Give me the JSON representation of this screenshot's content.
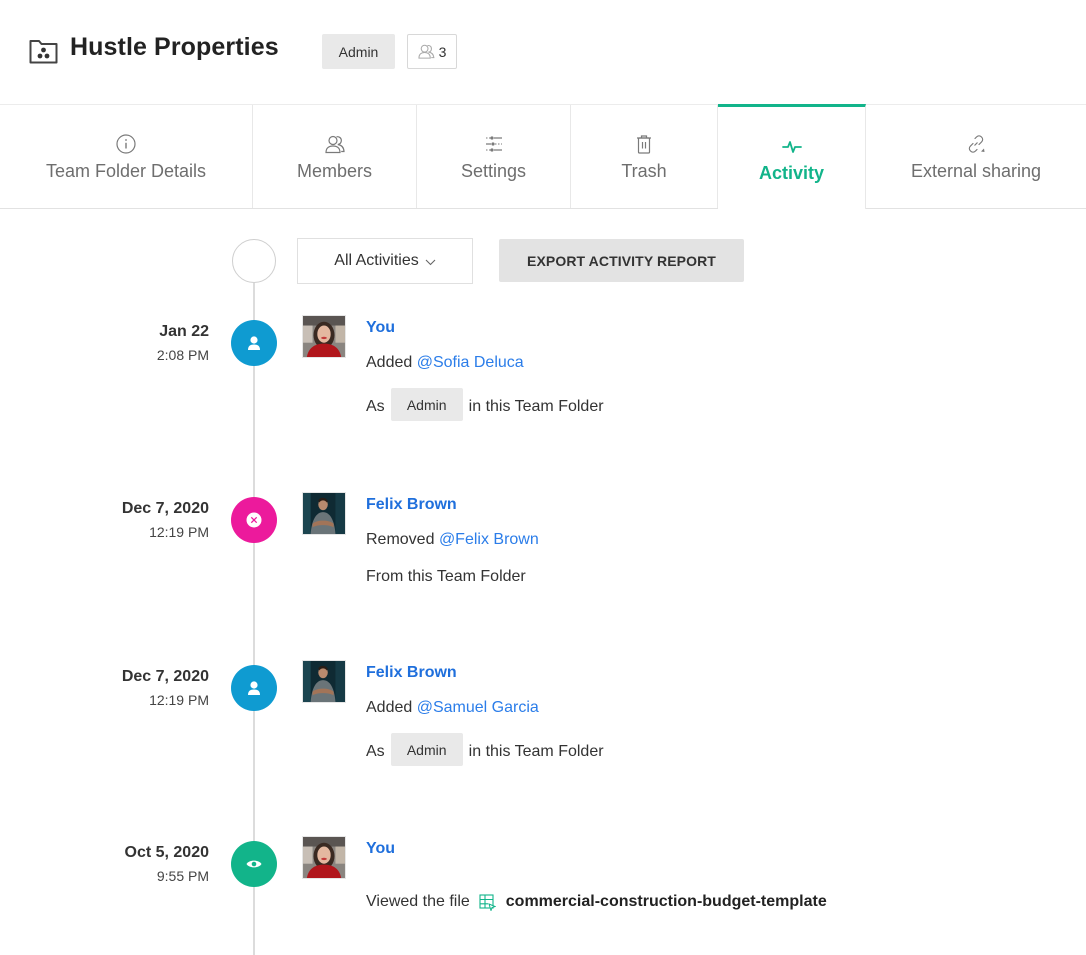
{
  "header": {
    "title": "Hustle Properties",
    "role_badge": "Admin",
    "member_count": "3",
    "folder_icon": "team-folder-icon",
    "members_icon": "members-icon"
  },
  "tabs": [
    {
      "label": "Team Folder Details",
      "icon": "info-icon",
      "active": false
    },
    {
      "label": "Members",
      "icon": "members-icon",
      "active": false
    },
    {
      "label": "Settings",
      "icon": "sliders-icon",
      "active": false
    },
    {
      "label": "Trash",
      "icon": "trash-icon",
      "active": false
    },
    {
      "label": "Activity",
      "icon": "activity-pulse-icon",
      "active": true
    },
    {
      "label": "External sharing",
      "icon": "link-icon",
      "active": false
    }
  ],
  "toolbar": {
    "filter_value": "All Activities",
    "export_label": "EXPORT ACTIVITY REPORT"
  },
  "colors": {
    "accent": "#12b48a",
    "link": "#1f6fdc",
    "mention": "#2b7de9",
    "marker_added": "#0f9bd1",
    "marker_removed": "#ec1a9c",
    "marker_viewed": "#12b48a"
  },
  "activities": [
    {
      "date": "Jan 22",
      "time": "2:08 PM",
      "type": "added",
      "marker_icon": "user-icon",
      "actor": "You",
      "action": "Added",
      "target": "@Sofia Deluca",
      "prefix": "As",
      "role": "Admin",
      "suffix": "in this Team Folder"
    },
    {
      "date": "Dec 7, 2020",
      "time": "12:19 PM",
      "type": "removed",
      "marker_icon": "remove-icon",
      "actor": "Felix Brown",
      "action": "Removed",
      "target": "@Felix Brown",
      "detail": "From this Team Folder"
    },
    {
      "date": "Dec 7, 2020",
      "time": "12:19 PM",
      "type": "added",
      "marker_icon": "user-icon",
      "actor": "Felix Brown",
      "action": "Added",
      "target": "@Samuel Garcia",
      "prefix": "As",
      "role": "Admin",
      "suffix": "in this Team Folder"
    },
    {
      "date": "Oct 5, 2020",
      "time": "9:55 PM",
      "type": "viewed",
      "marker_icon": "eye-icon",
      "actor": "You",
      "action": "Viewed the file",
      "file_icon": "spreadsheet-icon",
      "file_name": "commercial-construction-budget-template"
    }
  ]
}
